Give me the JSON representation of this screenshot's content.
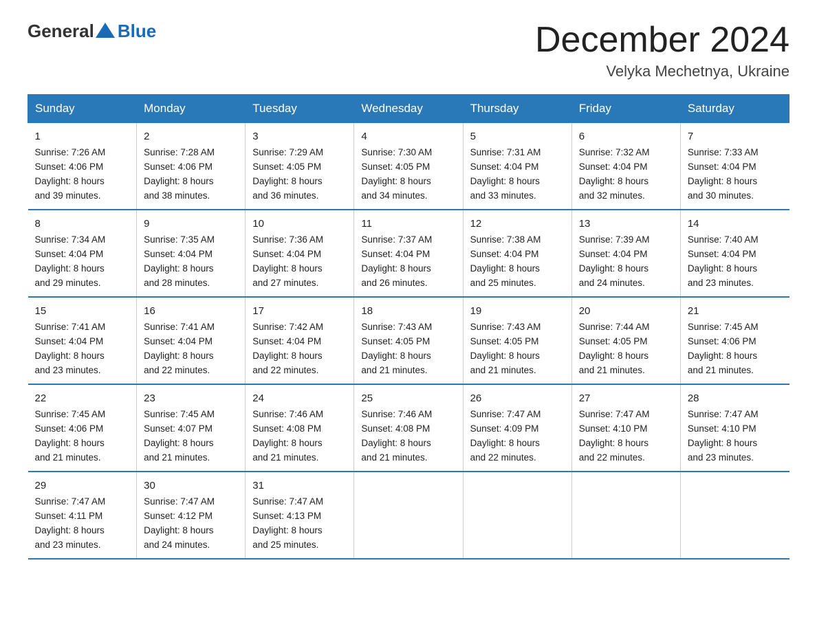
{
  "header": {
    "logo_general": "General",
    "logo_blue": "Blue",
    "month_title": "December 2024",
    "location": "Velyka Mechetnya, Ukraine"
  },
  "days_of_week": [
    "Sunday",
    "Monday",
    "Tuesday",
    "Wednesday",
    "Thursday",
    "Friday",
    "Saturday"
  ],
  "weeks": [
    [
      {
        "day": "1",
        "sunrise": "7:26 AM",
        "sunset": "4:06 PM",
        "daylight": "8 hours and 39 minutes."
      },
      {
        "day": "2",
        "sunrise": "7:28 AM",
        "sunset": "4:06 PM",
        "daylight": "8 hours and 38 minutes."
      },
      {
        "day": "3",
        "sunrise": "7:29 AM",
        "sunset": "4:05 PM",
        "daylight": "8 hours and 36 minutes."
      },
      {
        "day": "4",
        "sunrise": "7:30 AM",
        "sunset": "4:05 PM",
        "daylight": "8 hours and 34 minutes."
      },
      {
        "day": "5",
        "sunrise": "7:31 AM",
        "sunset": "4:04 PM",
        "daylight": "8 hours and 33 minutes."
      },
      {
        "day": "6",
        "sunrise": "7:32 AM",
        "sunset": "4:04 PM",
        "daylight": "8 hours and 32 minutes."
      },
      {
        "day": "7",
        "sunrise": "7:33 AM",
        "sunset": "4:04 PM",
        "daylight": "8 hours and 30 minutes."
      }
    ],
    [
      {
        "day": "8",
        "sunrise": "7:34 AM",
        "sunset": "4:04 PM",
        "daylight": "8 hours and 29 minutes."
      },
      {
        "day": "9",
        "sunrise": "7:35 AM",
        "sunset": "4:04 PM",
        "daylight": "8 hours and 28 minutes."
      },
      {
        "day": "10",
        "sunrise": "7:36 AM",
        "sunset": "4:04 PM",
        "daylight": "8 hours and 27 minutes."
      },
      {
        "day": "11",
        "sunrise": "7:37 AM",
        "sunset": "4:04 PM",
        "daylight": "8 hours and 26 minutes."
      },
      {
        "day": "12",
        "sunrise": "7:38 AM",
        "sunset": "4:04 PM",
        "daylight": "8 hours and 25 minutes."
      },
      {
        "day": "13",
        "sunrise": "7:39 AM",
        "sunset": "4:04 PM",
        "daylight": "8 hours and 24 minutes."
      },
      {
        "day": "14",
        "sunrise": "7:40 AM",
        "sunset": "4:04 PM",
        "daylight": "8 hours and 23 minutes."
      }
    ],
    [
      {
        "day": "15",
        "sunrise": "7:41 AM",
        "sunset": "4:04 PM",
        "daylight": "8 hours and 23 minutes."
      },
      {
        "day": "16",
        "sunrise": "7:41 AM",
        "sunset": "4:04 PM",
        "daylight": "8 hours and 22 minutes."
      },
      {
        "day": "17",
        "sunrise": "7:42 AM",
        "sunset": "4:04 PM",
        "daylight": "8 hours and 22 minutes."
      },
      {
        "day": "18",
        "sunrise": "7:43 AM",
        "sunset": "4:05 PM",
        "daylight": "8 hours and 21 minutes."
      },
      {
        "day": "19",
        "sunrise": "7:43 AM",
        "sunset": "4:05 PM",
        "daylight": "8 hours and 21 minutes."
      },
      {
        "day": "20",
        "sunrise": "7:44 AM",
        "sunset": "4:05 PM",
        "daylight": "8 hours and 21 minutes."
      },
      {
        "day": "21",
        "sunrise": "7:45 AM",
        "sunset": "4:06 PM",
        "daylight": "8 hours and 21 minutes."
      }
    ],
    [
      {
        "day": "22",
        "sunrise": "7:45 AM",
        "sunset": "4:06 PM",
        "daylight": "8 hours and 21 minutes."
      },
      {
        "day": "23",
        "sunrise": "7:45 AM",
        "sunset": "4:07 PM",
        "daylight": "8 hours and 21 minutes."
      },
      {
        "day": "24",
        "sunrise": "7:46 AM",
        "sunset": "4:08 PM",
        "daylight": "8 hours and 21 minutes."
      },
      {
        "day": "25",
        "sunrise": "7:46 AM",
        "sunset": "4:08 PM",
        "daylight": "8 hours and 21 minutes."
      },
      {
        "day": "26",
        "sunrise": "7:47 AM",
        "sunset": "4:09 PM",
        "daylight": "8 hours and 22 minutes."
      },
      {
        "day": "27",
        "sunrise": "7:47 AM",
        "sunset": "4:10 PM",
        "daylight": "8 hours and 22 minutes."
      },
      {
        "day": "28",
        "sunrise": "7:47 AM",
        "sunset": "4:10 PM",
        "daylight": "8 hours and 23 minutes."
      }
    ],
    [
      {
        "day": "29",
        "sunrise": "7:47 AM",
        "sunset": "4:11 PM",
        "daylight": "8 hours and 23 minutes."
      },
      {
        "day": "30",
        "sunrise": "7:47 AM",
        "sunset": "4:12 PM",
        "daylight": "8 hours and 24 minutes."
      },
      {
        "day": "31",
        "sunrise": "7:47 AM",
        "sunset": "4:13 PM",
        "daylight": "8 hours and 25 minutes."
      },
      null,
      null,
      null,
      null
    ]
  ],
  "labels": {
    "sunrise": "Sunrise:",
    "sunset": "Sunset:",
    "daylight": "Daylight:"
  }
}
